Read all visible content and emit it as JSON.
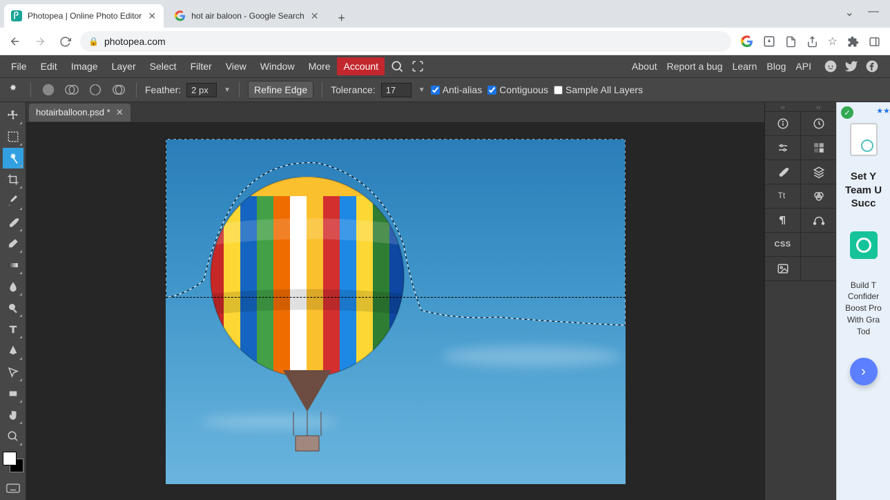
{
  "browser": {
    "tabs": [
      {
        "title": "Photopea | Online Photo Editor",
        "active": true
      },
      {
        "title": "hot air baloon - Google Search",
        "active": false
      }
    ],
    "url": "photopea.com"
  },
  "menu": {
    "items": [
      "File",
      "Edit",
      "Image",
      "Layer",
      "Select",
      "Filter",
      "View",
      "Window",
      "More"
    ],
    "account": "Account",
    "right_links": [
      "About",
      "Report a bug",
      "Learn",
      "Blog",
      "API"
    ]
  },
  "options": {
    "feather_label": "Feather:",
    "feather_value": "2 px",
    "refine_edge": "Refine Edge",
    "tolerance_label": "Tolerance:",
    "tolerance_value": "17",
    "anti_alias": "Anti-alias",
    "contiguous": "Contiguous",
    "sample_all": "Sample All Layers"
  },
  "document": {
    "tab_name": "hotairballoon.psd *"
  },
  "ad": {
    "headline1": "Set Y",
    "headline2": "Team U",
    "headline3": "Succ",
    "body1": "Build T",
    "body2": "Confider",
    "body3": "Boost Pro",
    "body4": "With Gra",
    "body5": "Tod"
  },
  "checks": {
    "aa": true,
    "contig": true,
    "sampleall": false
  }
}
